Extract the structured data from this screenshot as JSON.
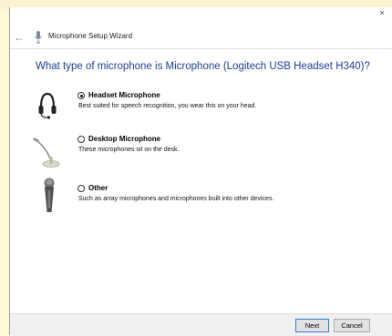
{
  "window": {
    "close_label": "×",
    "back_label": "←",
    "title": "Microphone Setup Wizard"
  },
  "question": "What type of microphone is Microphone (Logitech USB Headset H340)?",
  "options": [
    {
      "label": "Headset Microphone",
      "description": "Best suited for speech recognition, you wear this on your head.",
      "selected": true,
      "icon": "headset-icon"
    },
    {
      "label": "Desktop Microphone",
      "description": "These microphones sit on the desk.",
      "selected": false,
      "icon": "desktop-microphone-icon"
    },
    {
      "label": "Other",
      "description": "Such as array microphones and microphones built into other devices.",
      "selected": false,
      "icon": "handheld-microphone-icon"
    }
  ],
  "buttons": {
    "next": "Next",
    "cancel": "Cancel"
  },
  "colors": {
    "question_text": "#1e3e98",
    "desktop_background": "#fdf8d8",
    "accent_border": "#2a7fd2"
  }
}
